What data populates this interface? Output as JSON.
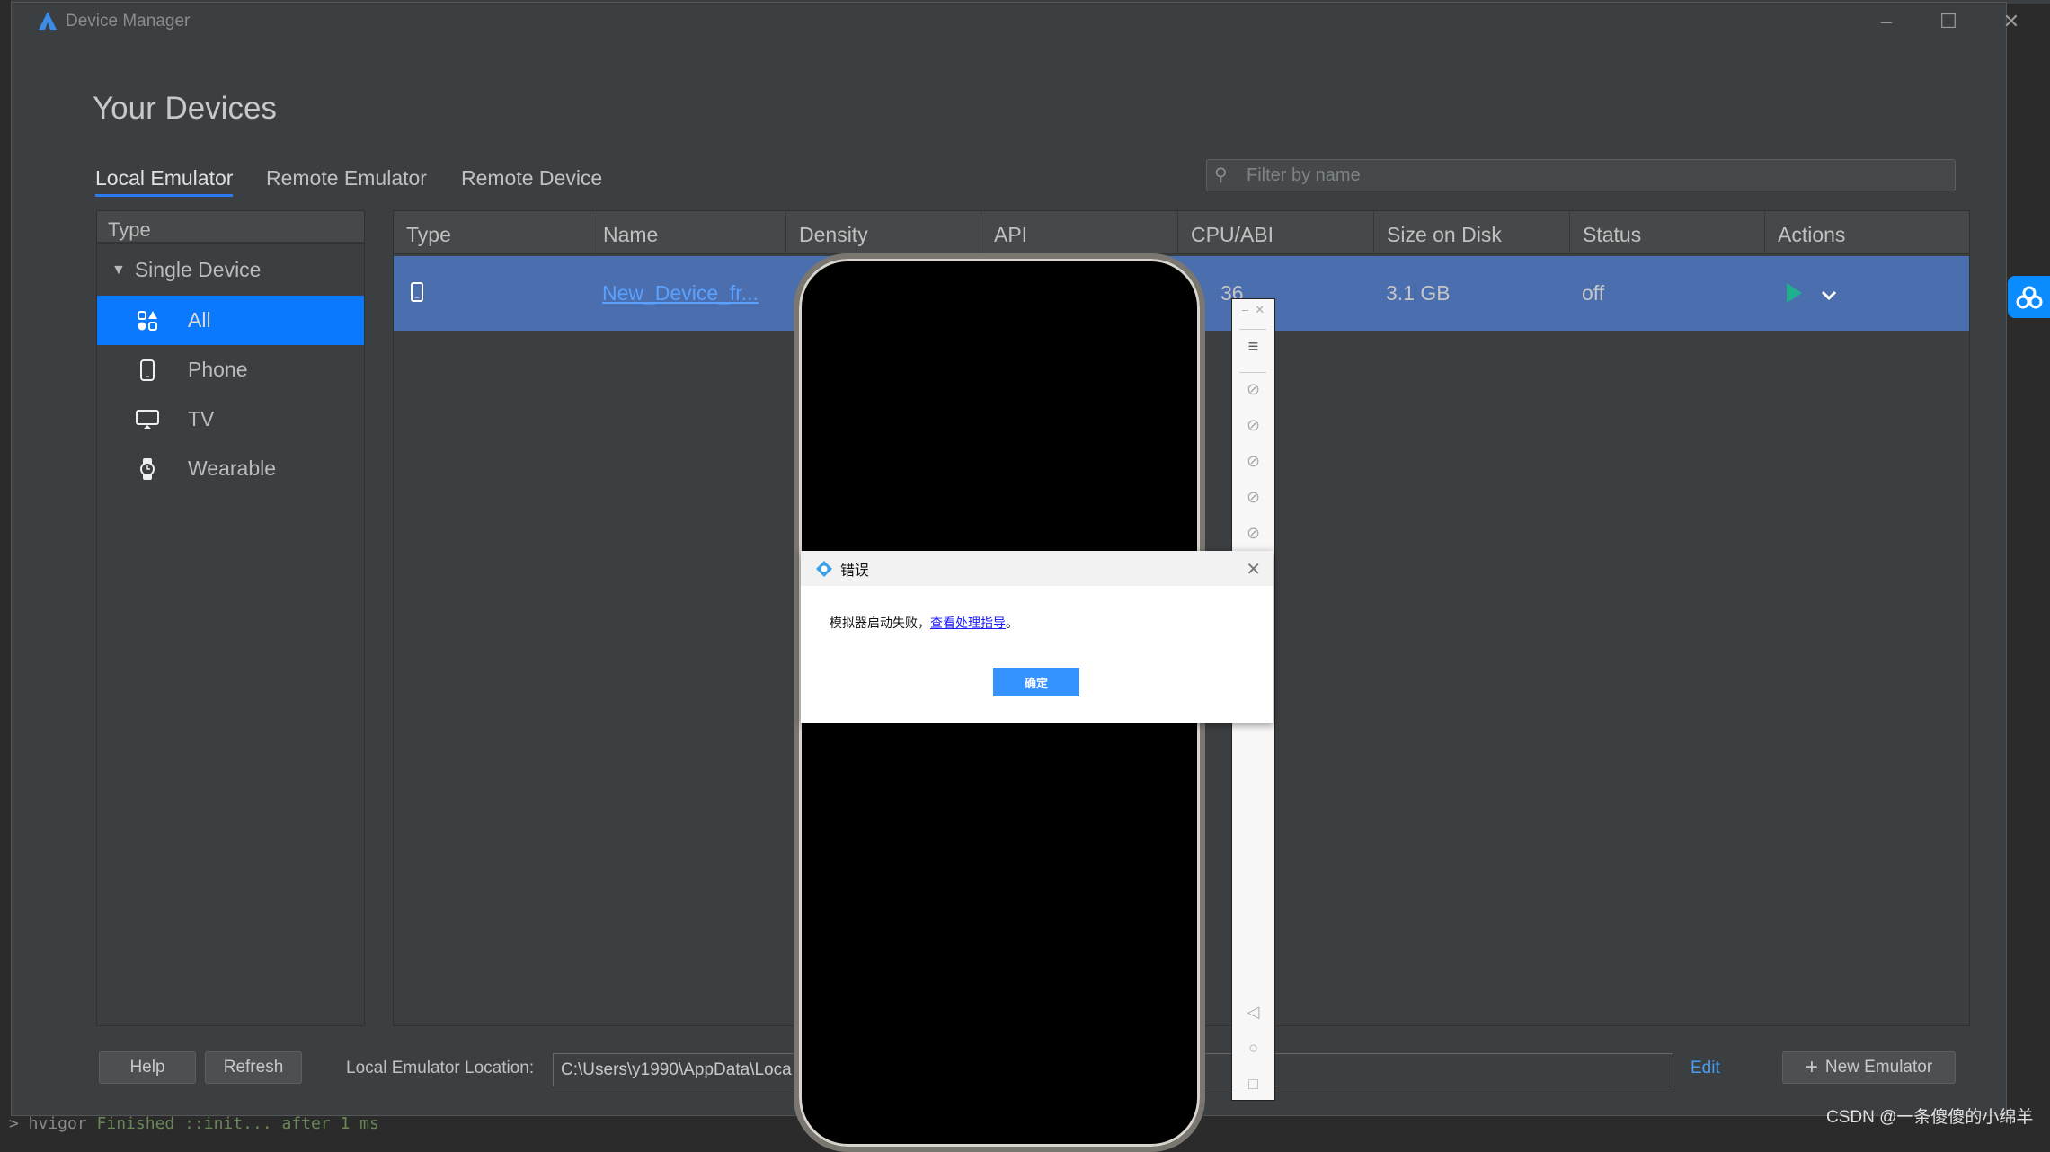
{
  "window": {
    "title": "Device Manager"
  },
  "page": {
    "heading": "Your Devices"
  },
  "tabs": [
    {
      "label": "Local Emulator",
      "active": true
    },
    {
      "label": "Remote Emulator"
    },
    {
      "label": "Remote Device"
    }
  ],
  "filter": {
    "placeholder": "Filter by name"
  },
  "type_panel": {
    "header": "Type",
    "group": "Single Device",
    "items": [
      {
        "label": "All",
        "icon": "categories-icon",
        "selected": true
      },
      {
        "label": "Phone",
        "icon": "phone-icon"
      },
      {
        "label": "TV",
        "icon": "tv-icon"
      },
      {
        "label": "Wearable",
        "icon": "watch-icon"
      }
    ]
  },
  "table": {
    "columns": [
      "Type",
      "Name",
      "Density",
      "API",
      "CPU/ABI",
      "Size on Disk",
      "Status",
      "Actions"
    ],
    "rows": [
      {
        "type_icon": "phone-icon",
        "name": "New_Device_fr...",
        "cpu_partial": "36",
        "size": "3.1 GB",
        "status": "off"
      }
    ]
  },
  "footer": {
    "help": "Help",
    "refresh": "Refresh",
    "location_label": "Local Emulator Location:",
    "location_value": "C:\\Users\\y1990\\AppData\\Loca",
    "edit": "Edit",
    "new_emulator": "New Emulator"
  },
  "dialog": {
    "title": "错误",
    "message": "模拟器启动失败，",
    "link": "查看处理指导",
    "suffix": "。",
    "ok": "确定"
  },
  "console": {
    "prefix": "> hvigor ",
    "text": "Finished ::init... after 1 ms"
  },
  "watermark": "CSDN @一条傻傻的小绵羊",
  "colors": {
    "accent": "#0a79fe",
    "selected_row": "#4b6eaf",
    "play": "#21b08f"
  }
}
